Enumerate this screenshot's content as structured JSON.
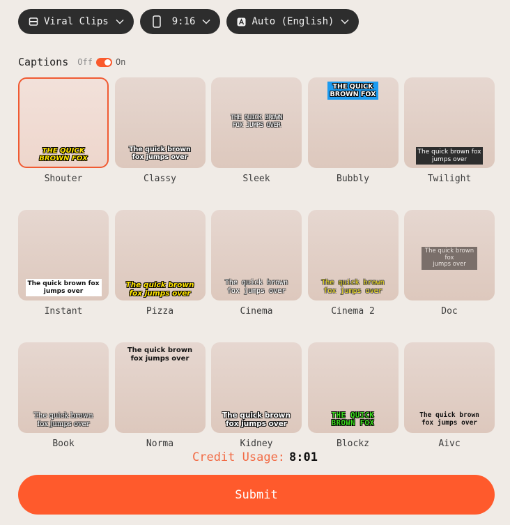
{
  "toolbar": {
    "clip_type": {
      "label": "Viral Clips",
      "icon": "film-icon"
    },
    "aspect_ratio": {
      "label": "9:16",
      "icon": "phone-portrait-icon"
    },
    "language": {
      "label": "Auto (English)",
      "icon": "translate-icon"
    }
  },
  "captions": {
    "title": "Captions",
    "toggle_off_label": "Off",
    "toggle_on_label": "On",
    "enabled": true
  },
  "styles": [
    {
      "name": "Shouter",
      "sample": "THE QUICK\nBROWN FOX",
      "selected": true
    },
    {
      "name": "Classy",
      "sample": "The quick brown\nfox jumps over"
    },
    {
      "name": "Sleek",
      "sample": "THE QUICK BROWN\nFOX JUMPS OVER"
    },
    {
      "name": "Bubbly",
      "sample": "THE QUICK\nBROWN FOX"
    },
    {
      "name": "Twilight",
      "sample": "The quick brown fox\njumps over"
    },
    {
      "name": "Instant",
      "sample": "The quick brown fox\njumps over"
    },
    {
      "name": "Pizza",
      "sample": "The quick brown\nfox jumps over"
    },
    {
      "name": "Cinema",
      "sample": "The quick brown\nfox jumps over"
    },
    {
      "name": "Cinema 2",
      "sample": "The quick brown\nfox jumps over"
    },
    {
      "name": "Doc",
      "sample": "The quick brown fox\njumps over"
    },
    {
      "name": "Book",
      "sample": "The quick brown\nfox jumps over"
    },
    {
      "name": "Norma",
      "sample": "The quick brown\nfox jumps over"
    },
    {
      "name": "Kidney",
      "sample": "The quick brown\nfox jumps over"
    },
    {
      "name": "Blockz",
      "sample": "THE QUICK\nBROWN FOX"
    },
    {
      "name": "Aivc",
      "sample": "The quick brown\nfox jumps over"
    }
  ],
  "credit": {
    "label": "Credit Usage:",
    "value": "8:01"
  },
  "submit_label": "Submit",
  "colors": {
    "accent": "#ff5a2c",
    "pill_bg": "#2d2d2d",
    "page_bg": "#f0ebe6"
  }
}
